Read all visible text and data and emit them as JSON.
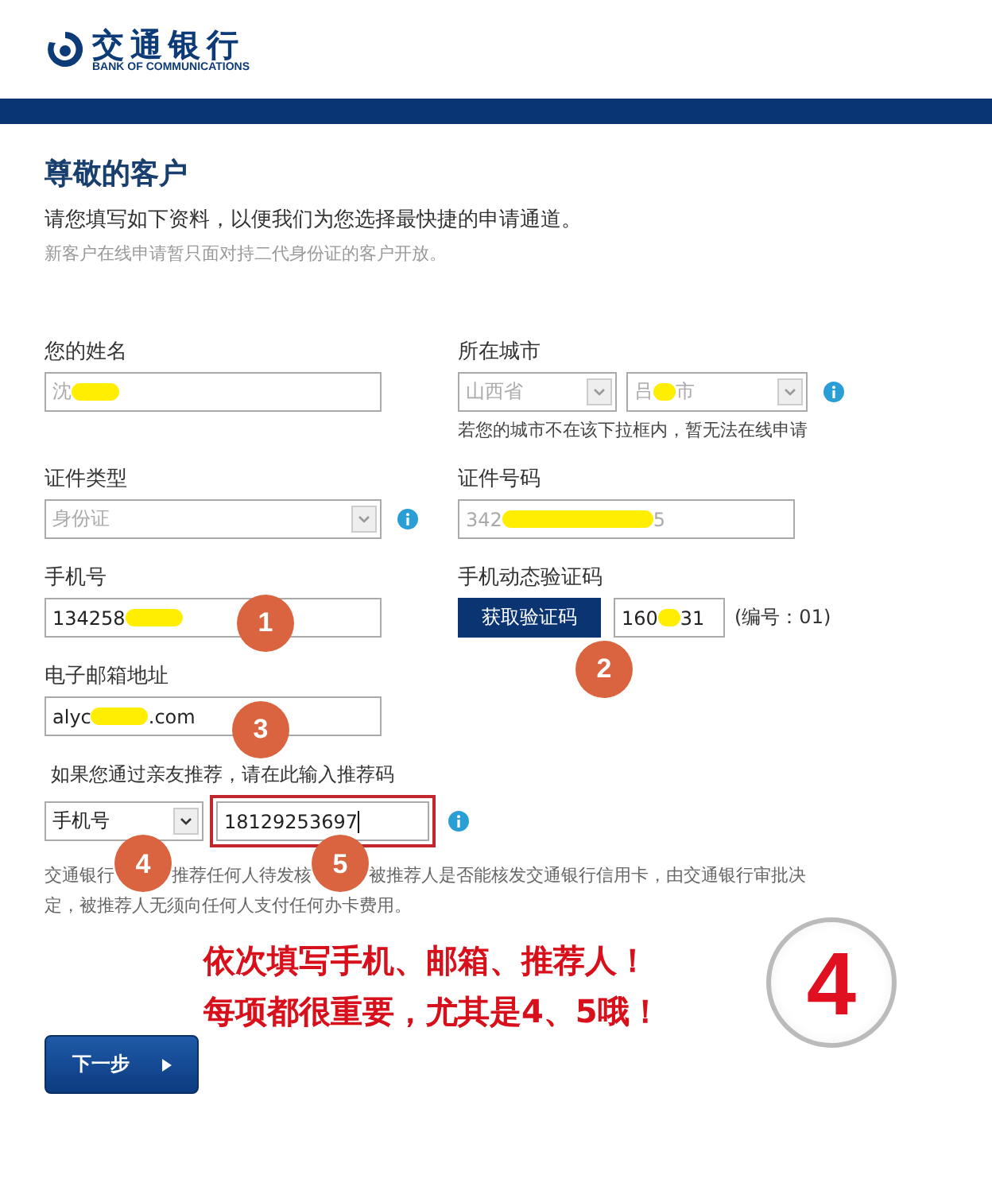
{
  "logo": {
    "name": "交通银行",
    "subtitle": "BANK OF COMMUNICATIONS"
  },
  "heading": "尊敬的客户",
  "intro": "请您填写如下资料，以便我们为您选择最快捷的申请通道。",
  "note": "新客户在线申请暂只面对持二代身份证的客户开放。",
  "fields": [
    {
      "kind": "text",
      "label": "您的姓名",
      "disabled": true,
      "value": [
        {
          "kind": "text",
          "text": "沈"
        },
        {
          "kind": "redaction"
        }
      ]
    },
    {
      "kind": "select_pair",
      "label": "所在城市",
      "disabled": true,
      "info": true,
      "options": [
        [
          {
            "kind": "text",
            "text": "山西省"
          }
        ],
        [
          {
            "kind": "text",
            "text": "吕"
          },
          {
            "kind": "redaction"
          },
          {
            "kind": "text",
            "text": "市"
          }
        ]
      ],
      "hint": "若您的城市不在该下拉框内，暂无法在线申请"
    },
    {
      "kind": "select",
      "label": "证件类型",
      "disabled": true,
      "info": true,
      "value": [
        {
          "kind": "text",
          "text": "身份证"
        }
      ]
    },
    {
      "kind": "text",
      "label": "证件号码",
      "disabled": true,
      "value": [
        {
          "kind": "text",
          "text": "342"
        },
        {
          "kind": "redaction"
        },
        {
          "kind": "text",
          "text": "5"
        }
      ]
    },
    {
      "kind": "text",
      "label": "手机号",
      "disabled": false,
      "value": [
        {
          "kind": "text",
          "text": "134258"
        },
        {
          "kind": "redaction"
        }
      ]
    },
    {
      "kind": "code",
      "label": "手机动态验证码",
      "disabled": false,
      "button": "获取验证码",
      "value": [
        {
          "kind": "text",
          "text": "160"
        },
        {
          "kind": "redaction"
        },
        {
          "kind": "text",
          "text": "31"
        }
      ],
      "serial": "(编号：01)"
    },
    {
      "kind": "text",
      "label": "电子邮箱地址",
      "disabled": false,
      "value": [
        {
          "kind": "text",
          "text": "alyc"
        },
        {
          "kind": "redaction"
        },
        {
          "kind": "text",
          "text": ".com"
        }
      ]
    }
  ],
  "referral": {
    "label": "如果您通过亲友推荐，请在此输入推荐码",
    "type": "手机号",
    "code": "18129253697",
    "highlighted": true,
    "focused": true,
    "info": true
  },
  "disclaimer": [
    "交通银行",
    "推荐任何人待发核",
    "被推荐人是否能核发交通银行信用卡，由交通银行审批决",
    "定，被推荐人无须向任何人支付任何办卡费用。"
  ],
  "markers": [
    "1",
    "2",
    "3",
    "4",
    "5"
  ],
  "callout": [
    "依次填写手机、邮箱、推荐人！",
    "每项都很重要，尤其是4、5哦！"
  ],
  "step": "4",
  "next_button": "下一步"
}
